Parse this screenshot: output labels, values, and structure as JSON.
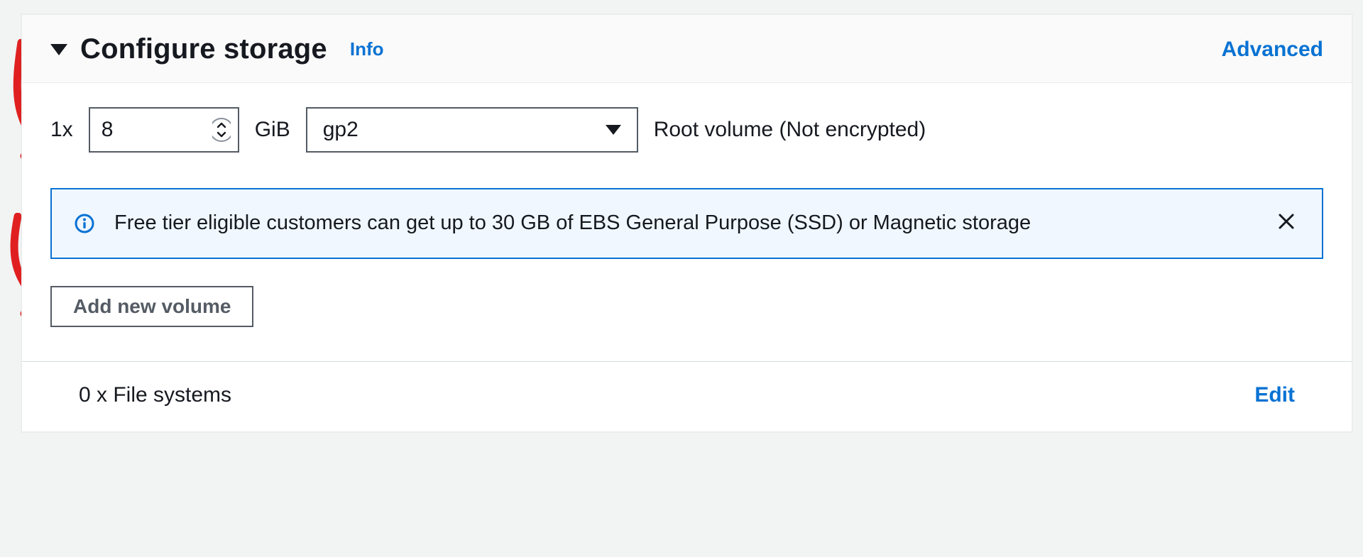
{
  "header": {
    "title": "Configure storage",
    "info_label": "Info",
    "advanced_label": "Advanced"
  },
  "volume": {
    "prefix": "1x",
    "size": "8",
    "unit": "GiB",
    "type_selected": "gp2",
    "description": "Root volume  (Not encrypted)"
  },
  "alert": {
    "text": "Free tier eligible customers can get up to 30 GB of EBS General Purpose (SSD) or Magnetic storage"
  },
  "actions": {
    "add_volume_label": "Add new volume"
  },
  "filesystems": {
    "summary": "0 x File systems",
    "edit_label": "Edit"
  },
  "colors": {
    "link": "#0972d3",
    "annotation": "#e02020"
  }
}
